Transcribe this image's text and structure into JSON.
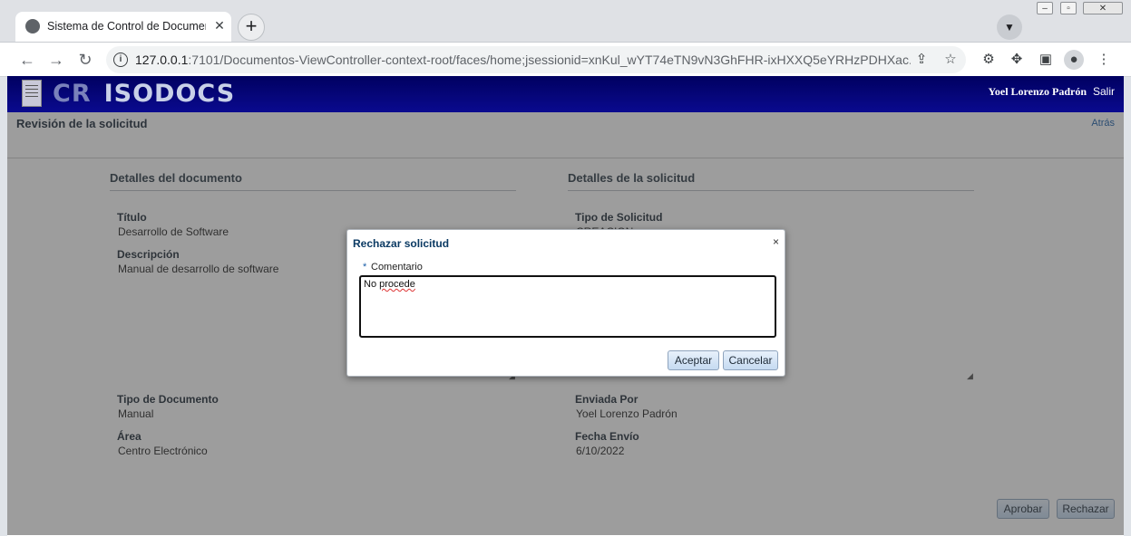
{
  "browser": {
    "tab_title": "Sistema de Control de Documentos",
    "tab_close": "✕",
    "new_tab": "+",
    "url_host": "127.0.0.1",
    "url_rest": ":7101/Documentos-ViewController-context-root/faces/home;jsessionid=xnKul_wYT74eTN9vN3GhFHR-ixHXXQ5eYRHzPDHXac...",
    "icons": [
      "globe-icon",
      "back-icon",
      "forward-icon",
      "reload-icon",
      "info-icon",
      "share-icon",
      "star-icon",
      "extension-icon",
      "puzzle-icon",
      "sidepanel-icon",
      "profile-icon",
      "menu-icon"
    ]
  },
  "app": {
    "logo_cr": "CR",
    "logo_name": "ISODOCS",
    "user_name": "Yoel Lorenzo Padrón",
    "logout": "Salir",
    "header_color": "#000080"
  },
  "page": {
    "title": "Revisión de la solicitud",
    "back": "Atrás"
  },
  "document_details": {
    "header": "Detalles del documento",
    "title_label": "Título",
    "title_value": "Desarrollo de Software",
    "description_label": "Descripción",
    "description_value": "Manual de desarrollo de software",
    "doc_type_label": "Tipo de Documento",
    "doc_type_value": "Manual",
    "area_label": "Área",
    "area_value": "Centro Electrónico"
  },
  "request_details": {
    "header": "Detalles de la solicitud",
    "request_type_label": "Tipo de Solicitud",
    "request_type_value": "CREACION",
    "sent_by_label": "Enviada Por",
    "sent_by_value": "Yoel Lorenzo Padrón",
    "sent_date_label": "Fecha Envío",
    "sent_date_value": "6/10/2022"
  },
  "actions": {
    "approve": "Aprobar",
    "reject": "Rechazar"
  },
  "dialog": {
    "title": "Rechazar solicitud",
    "close": "×",
    "required_mark": "*",
    "comment_label": "Comentario",
    "comment_value_word1": "No",
    "comment_value_word2": "procede",
    "accept": "Aceptar",
    "cancel": "Cancelar"
  }
}
